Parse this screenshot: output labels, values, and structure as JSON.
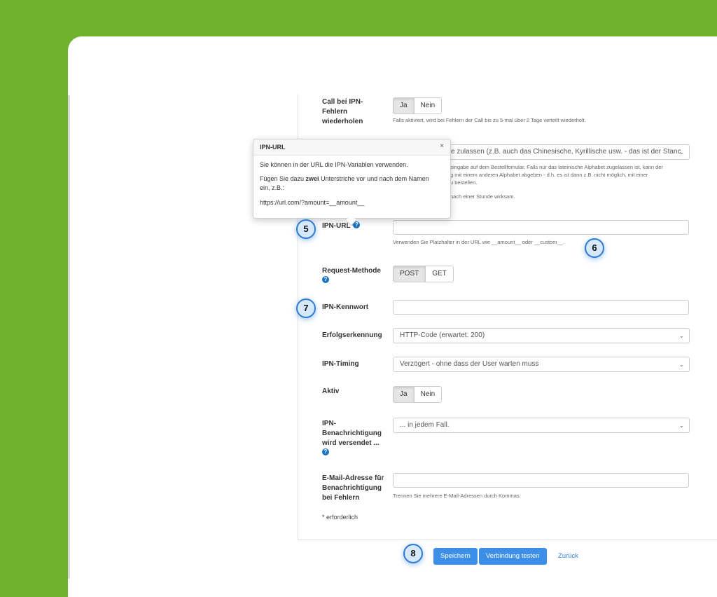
{
  "form": {
    "call_retry": {
      "label_lines": [
        "Call bei IPN-",
        "Fehlern",
        "wiederholen"
      ],
      "options": [
        "Ja",
        "Nein"
      ],
      "selected": "Ja",
      "hint": "Falls aktiviert, wird bei Fehlern der Call bis zu 5-mal über 2 Tage verteilt wiederholt."
    },
    "alphabet": {
      "value": "e zulassen (z.B. auch das Chinesische, Kyrillische usw. - das ist der Stanc",
      "hint_lines": [
        "eingabe auf dem Bestellfomular. Falls nur das lateinische Alphabet zugelassen ist, kann der",
        "g mit einem anderen Alphabet abgeben - d.h. es ist dann z.B. nicht möglich, mit einer",
        "u bestellen."
      ],
      "hint2": "nach einer Stunde wirksam."
    },
    "ipn_url": {
      "label": "IPN-URL*",
      "value": "",
      "hint": "Verwenden Sie Platzhalter in der URL wie __amount__ oder __custom__."
    },
    "request_method": {
      "label": "Request-Methode",
      "options": [
        "POST",
        "GET"
      ],
      "selected": "POST"
    },
    "ipn_password": {
      "label": "IPN-Kennwort",
      "value": ""
    },
    "success_detection": {
      "label": "Erfolgserkennung",
      "value": "HTTP-Code (erwartet: 200)"
    },
    "ipn_timing": {
      "label": "IPN-Timing",
      "value": "Verzögert - ohne dass der User warten muss"
    },
    "active": {
      "label": "Aktiv",
      "options": [
        "Ja",
        "Nein"
      ],
      "selected": "Ja"
    },
    "notification": {
      "label_lines": [
        "IPN-",
        "Benachrichtigung",
        "wird versendet ..."
      ],
      "value": "... in jedem Fall."
    },
    "error_email": {
      "label_lines": [
        "E-Mail-Adresse für",
        "Benachrichtigung",
        "bei Fehlern"
      ],
      "value": "",
      "hint": "Trennen Sie mehrere E-Mail-Adressen durch Kommas."
    },
    "required_note": "* erforderlich"
  },
  "popover": {
    "title": "IPN-URL",
    "close": "×",
    "line1": "Sie können in der URL die IPN-Variablen verwenden.",
    "line2_before": "Fügen Sie dazu ",
    "line2_bold": "zwei",
    "line2_after": " Unterstriche vor und nach dem Namen",
    "line3": "ein, z.B.:",
    "example": "https://url.com/?amount=__amount__"
  },
  "buttons": {
    "save": "Speichern",
    "test": "Verbindung testen",
    "back": "Zurück"
  },
  "steps": {
    "s5": "5",
    "s6": "6",
    "s7": "7",
    "s8": "8"
  },
  "icons": {
    "help": "question-circle-icon",
    "close": "close-icon",
    "chevron": "chevron-down-icon"
  },
  "colors": {
    "brand_green": "#70b22e",
    "primary": "#3d8ee6",
    "step_border": "#2d7ad6"
  }
}
